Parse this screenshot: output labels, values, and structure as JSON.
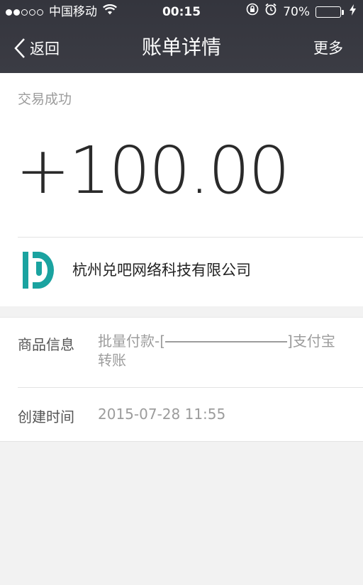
{
  "status_bar": {
    "carrier": "中国移动",
    "time": "00:15",
    "battery_percent": "70%",
    "battery_level": 0.7,
    "signal_strength": 2,
    "signal_max": 5
  },
  "nav": {
    "back_label": "返回",
    "title": "账单详情",
    "more_label": "更多"
  },
  "transaction": {
    "status": "交易成功",
    "amount": "+100.00"
  },
  "merchant": {
    "name": "杭州兑吧网络科技有限公司",
    "logo_color": "#1aa3a0"
  },
  "details": {
    "product_label": "商品信息",
    "product_value_prefix": "批量付款-[",
    "product_value_suffix": "]支付宝",
    "product_value_line2": "转账",
    "created_label": "创建时间",
    "created_value": "2015-07-28 11:55"
  },
  "colors": {
    "header_bg": "#383940",
    "battery_fill": "#4cd964"
  }
}
